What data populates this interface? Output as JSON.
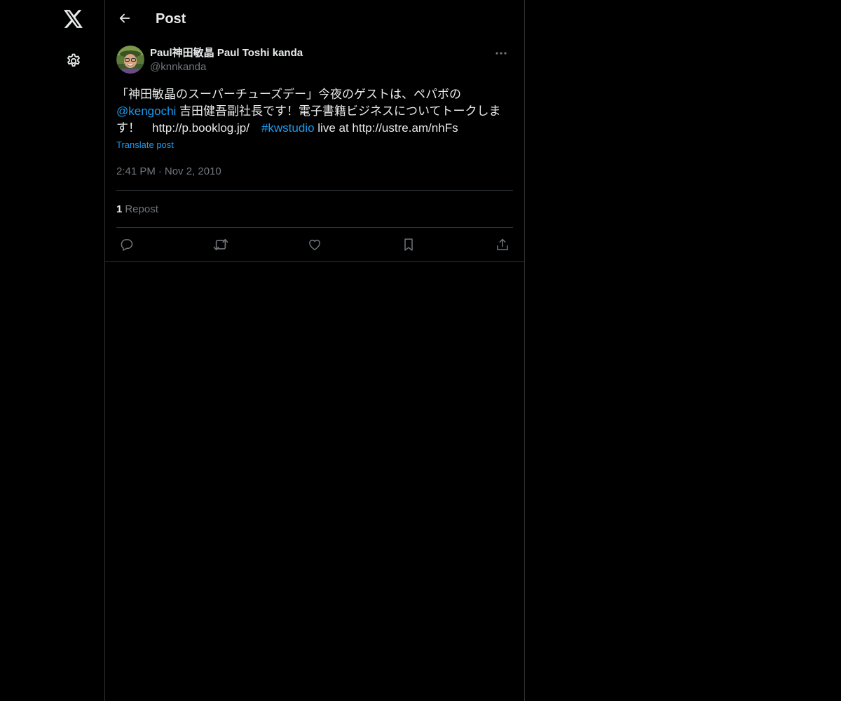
{
  "sidebar": {
    "logo_icon": "x-logo-icon",
    "settings_icon": "gear-icon"
  },
  "header": {
    "title": "Post",
    "back_icon": "arrow-left-icon"
  },
  "post": {
    "author": {
      "display_name": "Paul神田敏晶 Paul Toshi kanda",
      "handle": "@knnkanda"
    },
    "text": {
      "part1": "「神田敏晶のスーパーチューズデー」今夜のゲストは、ペパボの ",
      "mention": "@kengochi",
      "part2": " 吉田健吾副社長です！電子書籍ビジネスについてトークします！　http://p.booklog.jp/　",
      "hashtag": "#kwstudio",
      "part3": " live at http://ustre.am/nhFs"
    },
    "translate_label": "Translate post",
    "time": "2:41 PM",
    "separator": "·",
    "date": "Nov 2, 2010",
    "stats": {
      "repost_count": "1",
      "repost_label": "Repost"
    },
    "actions": [
      "reply-icon",
      "repost-icon",
      "like-icon",
      "bookmark-icon",
      "share-icon"
    ]
  },
  "colors": {
    "background": "#000000",
    "text": "#e7e9ea",
    "secondary": "#71767b",
    "accent": "#1d9bf0",
    "border": "#2f3336"
  }
}
